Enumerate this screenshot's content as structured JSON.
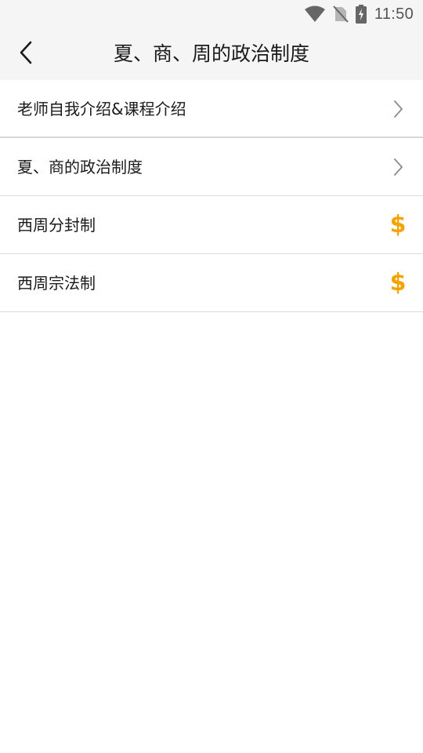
{
  "status_bar": {
    "time": "11:50",
    "icons": [
      "wifi-icon",
      "no-sim-icon",
      "battery-charging-icon"
    ]
  },
  "header": {
    "title": "夏、商、周的政治制度",
    "back_icon": "chevron-left-icon"
  },
  "lessons": [
    {
      "label": "老师自我介绍&课程介绍",
      "icon": "chevron-right-icon"
    },
    {
      "label": "夏、商的政治制度",
      "icon": "chevron-right-icon"
    },
    {
      "label": "西周分封制",
      "icon": "dollar-icon",
      "icon_glyph": "$"
    },
    {
      "label": "西周宗法制",
      "icon": "dollar-icon",
      "icon_glyph": "$"
    }
  ],
  "colors": {
    "accent": "#f5a300",
    "header_bg": "#f5f5f5",
    "divider": "#dcdcdc",
    "chevron": "#8a8a8a"
  }
}
